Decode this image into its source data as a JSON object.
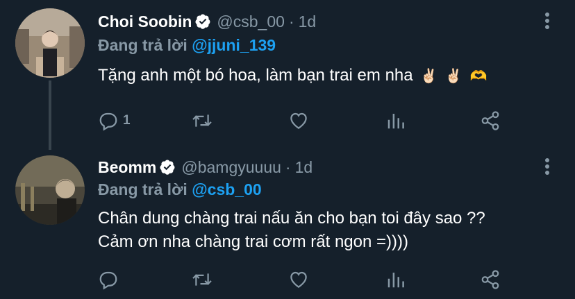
{
  "tweets": [
    {
      "name": "Choi Soobin",
      "handle": "@csb_00",
      "time": "1d",
      "reply_label": "Đang trả lời",
      "reply_to": "@jjuni_139",
      "text": "Tặng anh một bó hoa, làm bạn trai em nha",
      "emojis": [
        "✌🏻",
        "✌🏻",
        "🫶"
      ],
      "reply_count": "1",
      "icons": [
        "reply-icon",
        "retweet-icon",
        "like-icon",
        "analytics-icon",
        "share-icon"
      ]
    },
    {
      "name": "Beomm",
      "handle": "@bamgyuuuu",
      "time": "1d",
      "reply_label": "Đang trả lời",
      "reply_to": "@csb_00",
      "text_line1": "Chân dung chàng trai nấu ăn cho bạn toi đây sao ??",
      "text_line2": "Cảm ơn nha chàng trai cơm rất ngon =))))",
      "icons": [
        "reply-icon",
        "retweet-icon",
        "like-icon",
        "analytics-icon",
        "share-icon"
      ]
    }
  ],
  "colors": {
    "background": "#15202b",
    "secondary_text": "#8899a6",
    "link": "#1da1f2",
    "verified_badge": "#ffffff"
  }
}
